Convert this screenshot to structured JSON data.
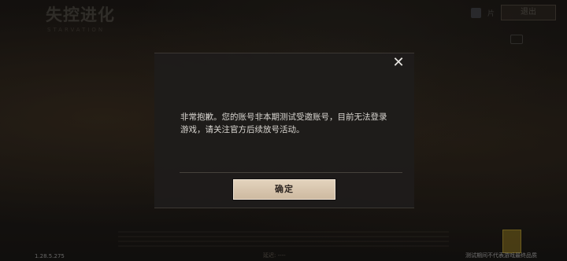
{
  "background": {
    "logo_text": "失控进化",
    "logo_sub": "STARVATION",
    "exit_label": "退出",
    "flag_label": "片",
    "version": "1.28.5.275",
    "footer_left": "延迟: ----",
    "footer_right": "测试期间不代表游戏最终品质"
  },
  "dialog": {
    "message": "非常抱歉。您的账号非本期测试受邀账号，目前无法登录游戏，请关注官方后续放号活动。",
    "confirm_label": "确定",
    "close_icon": "✕"
  },
  "colors": {
    "dialog_bg": "#1e1c1b",
    "button_bg": "#d9c7af",
    "text": "#d9d6d1"
  }
}
